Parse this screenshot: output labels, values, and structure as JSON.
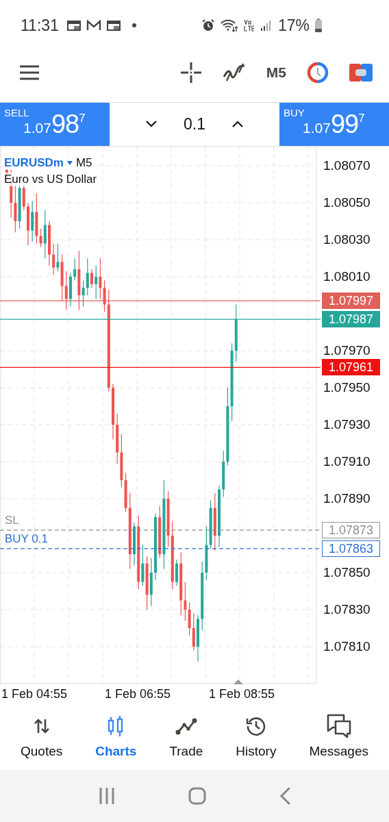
{
  "status_bar": {
    "time": "11:31",
    "battery": "17%"
  },
  "toolbar": {
    "timeframe": "M5"
  },
  "trade_bar": {
    "sell": {
      "label": "SELL",
      "price_head": "1.07",
      "price_big": "98",
      "price_tail": "7"
    },
    "volume": "0.1",
    "buy": {
      "label": "BUY",
      "price_head": "1.07",
      "price_big": "99",
      "price_tail": "7"
    }
  },
  "chart": {
    "symbol": "EURUSDm",
    "timeframe": "M5",
    "description": "Euro vs US Dollar",
    "price_axis": [
      "1.08070",
      "1.08050",
      "1.08030",
      "1.08010",
      "1.07970",
      "1.07950",
      "1.07930",
      "1.07910",
      "1.07890",
      "1.07850",
      "1.07830",
      "1.07810"
    ],
    "price_lines": [
      {
        "kind": "ask",
        "price": "1.07997"
      },
      {
        "kind": "bid",
        "price": "1.07987"
      },
      {
        "kind": "alert",
        "price": "1.07961"
      },
      {
        "kind": "stop_loss",
        "label": "SL",
        "price": "1.07873"
      },
      {
        "kind": "position",
        "label": "BUY 0.1",
        "price": "1.07863"
      }
    ],
    "time_axis": [
      "1 Feb 04:55",
      "1 Feb 06:55",
      "1 Feb 08:55"
    ]
  },
  "bottom_nav": [
    {
      "label": "Quotes",
      "selected": false
    },
    {
      "label": "Charts",
      "selected": true
    },
    {
      "label": "Trade",
      "selected": false
    },
    {
      "label": "History",
      "selected": false
    },
    {
      "label": "Messages",
      "selected": false
    }
  ]
}
